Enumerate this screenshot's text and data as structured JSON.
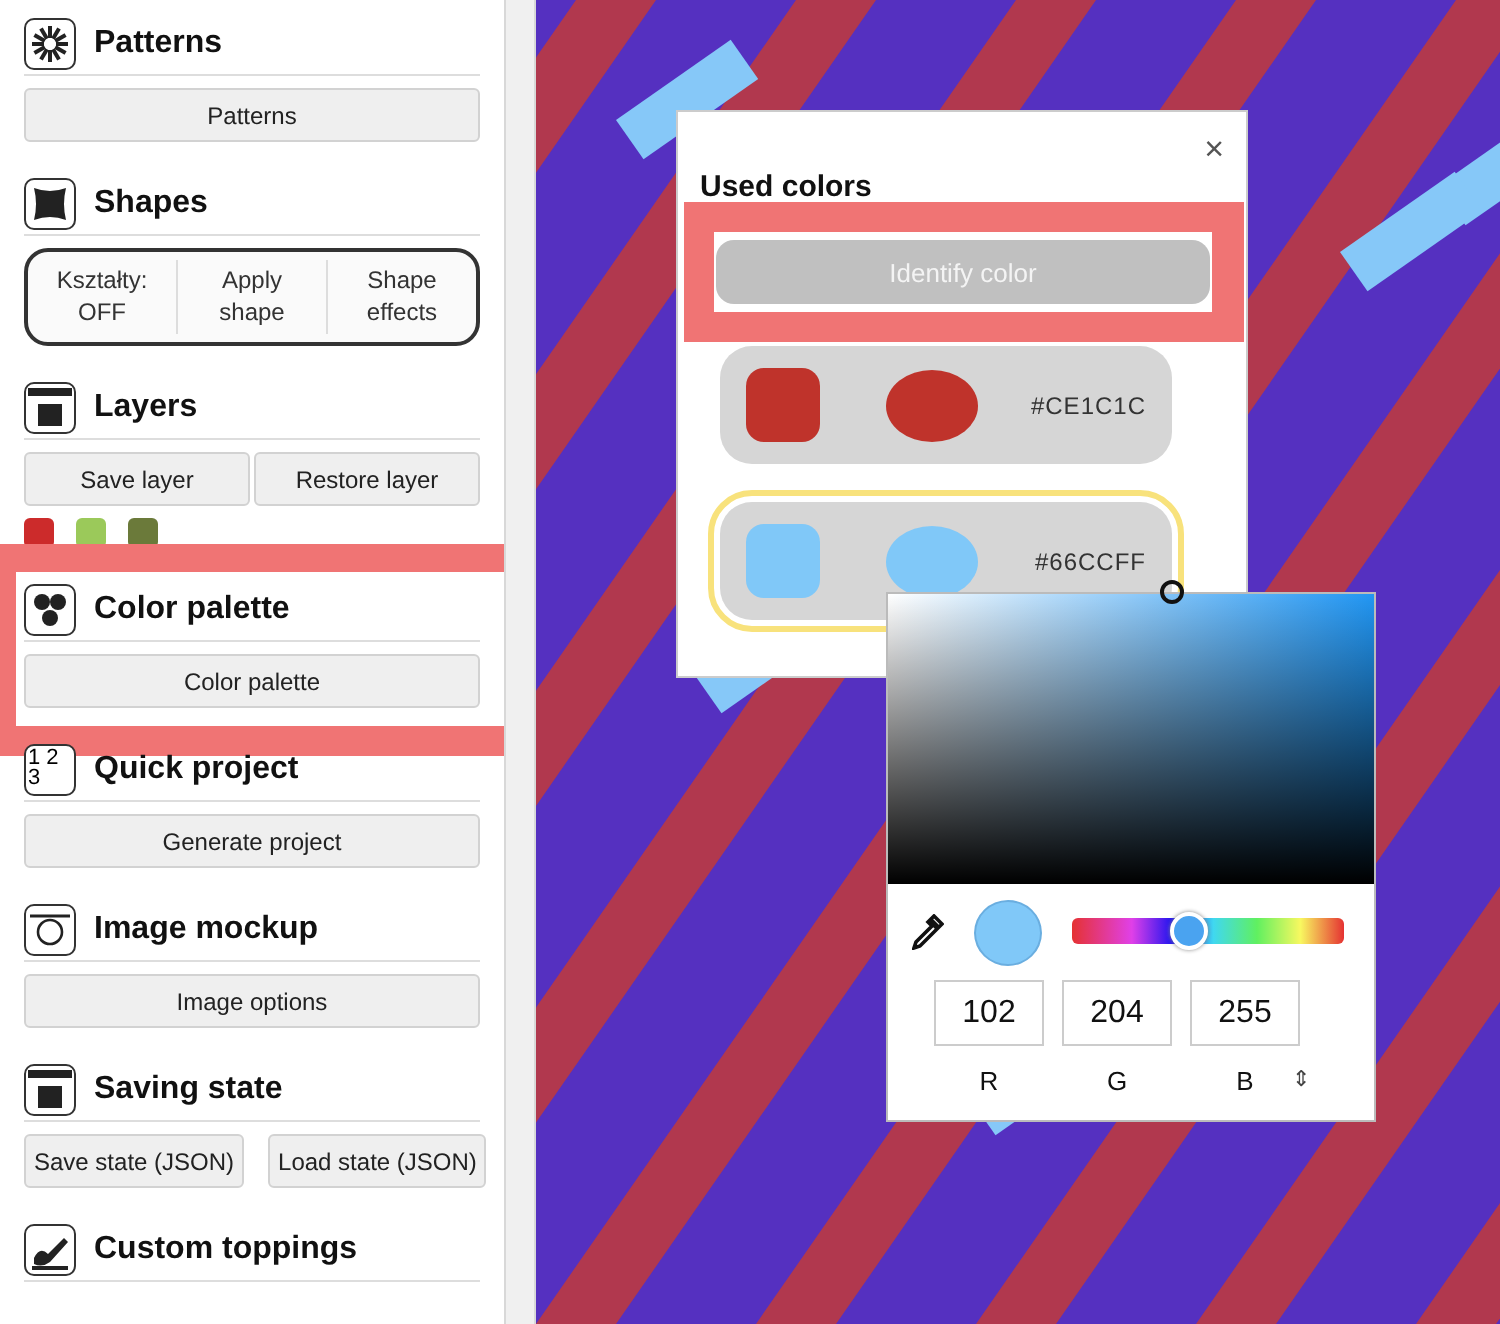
{
  "sidebar": {
    "sections": [
      {
        "title": "Patterns",
        "kind": "single",
        "buttons": [
          "Patterns"
        ],
        "highlighted": false
      },
      {
        "title": "Shapes",
        "kind": "segmented",
        "buttons": [
          "Kształty: OFF",
          "Apply shape",
          "Shape effects"
        ],
        "highlighted": false
      },
      {
        "title": "Layers",
        "kind": "pair",
        "buttons": [
          "Save layer",
          "Restore layer"
        ],
        "swatches": [
          {
            "color": "#cc2b2b"
          },
          {
            "color": "#9bc95a"
          },
          {
            "color": "#6b7a3a"
          }
        ],
        "highlighted": false
      },
      {
        "title": "Color palette",
        "kind": "single",
        "buttons": [
          "Color palette"
        ],
        "highlighted": true
      },
      {
        "title": "Quick project",
        "icon_text": "1 2 3",
        "kind": "single",
        "buttons": [
          "Generate project"
        ],
        "highlighted": false
      },
      {
        "title": "Image mockup",
        "kind": "single",
        "buttons": [
          "Image options"
        ],
        "highlighted": false
      },
      {
        "title": "Saving state",
        "kind": "pair",
        "buttons": [
          "Save state (JSON)",
          "Load state (JSON)"
        ],
        "highlighted": false
      },
      {
        "title": "Custom toppings",
        "kind": "none",
        "highlighted": false
      }
    ]
  },
  "dialog": {
    "title": "Used colors",
    "close": "×",
    "identify_button": {
      "label": "Identify color",
      "highlighted": true
    },
    "colors": [
      {
        "hex": "#CE1C1C",
        "color": "#bf332b",
        "selected": false
      },
      {
        "hex": "#66CCFF",
        "color": "#80c8f8",
        "selected": true
      }
    ]
  },
  "picker": {
    "color": "#80c8f8",
    "hue": {
      "level": 0.43
    },
    "channels": [
      {
        "value": "102",
        "label": "R"
      },
      {
        "value": "204",
        "label": "G"
      },
      {
        "value": "255",
        "label": "B"
      }
    ],
    "mode_toggle": "⇕"
  }
}
